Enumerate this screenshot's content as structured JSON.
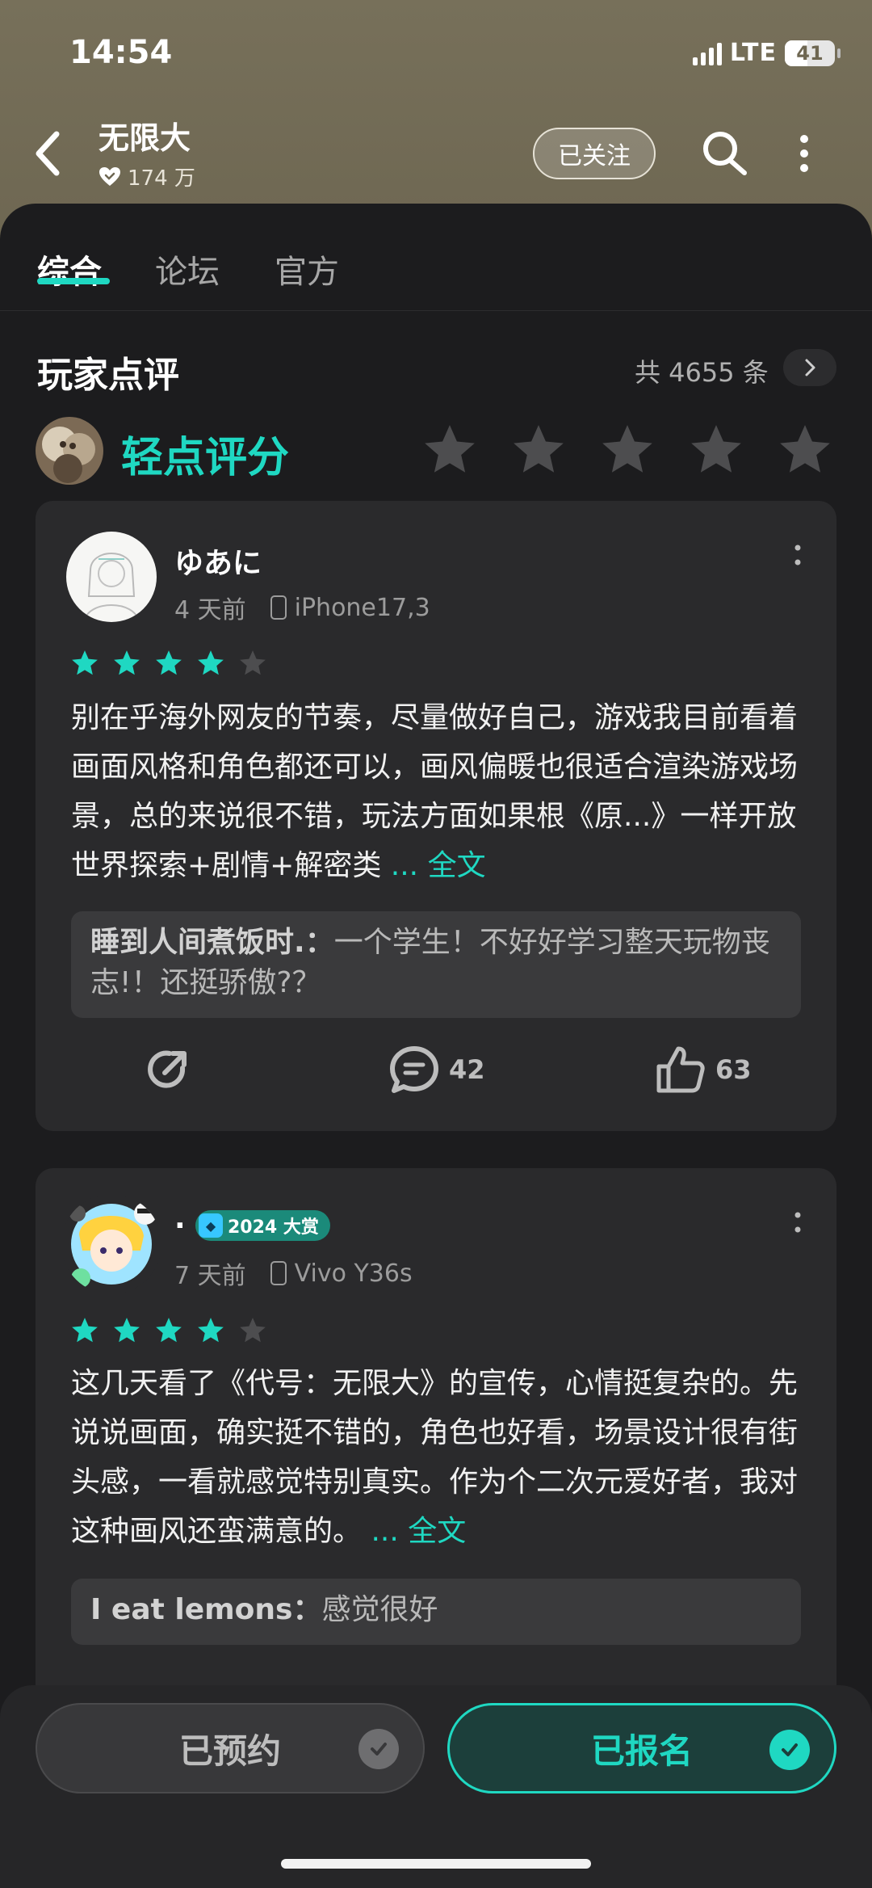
{
  "status_bar": {
    "time": "14:54",
    "network": "LTE",
    "battery": "41"
  },
  "header": {
    "title": "无限大",
    "followers": "174 万",
    "follow_label": "已关注"
  },
  "tabs": [
    {
      "label": "综合",
      "active": true
    },
    {
      "label": "论坛",
      "active": false
    },
    {
      "label": "官方",
      "active": false
    }
  ],
  "reviews_section": {
    "title": "玩家点评",
    "count": "共 4655 条",
    "rate_label": "轻点评分"
  },
  "reviews": [
    {
      "username": "ゆあに",
      "time": "4 天前",
      "device": "iPhone17,3",
      "rating": 4,
      "text": "别在乎海外网友的节奏，尽量做好自己，游戏我目前看着画面风格和角色都还可以，画风偏暖也很适合渲染游戏场景，总的来说很不错，玩法方面如果根《原...》一样开放世界探索+剧情+解密类",
      "more": "... 全文",
      "reply_author": "睡到人间煮饭时.",
      "reply_sep": "：",
      "reply_text": "一个学生！不好好学习整天玩物丧志!！还挺骄傲?？",
      "comments": "42",
      "likes": "63"
    },
    {
      "username": ".",
      "badge": "2024 大赏",
      "time": "7 天前",
      "device": "Vivo Y36s",
      "rating": 4,
      "text": "这几天看了《代号：无限大》的宣传，心情挺复杂的。先说说画面，确实挺不错的，角色也好看，场景设计很有街头感，一看就感觉特别真实。作为个二次元爱好者，我对这种画风还蛮满意的。",
      "more": "... 全文",
      "reply_author": "I eat lemons",
      "reply_sep": "：",
      "reply_text": "感觉很好"
    }
  ],
  "bottom_actions": {
    "reserved_label": "已预约",
    "signed_label": "已报名"
  },
  "colors": {
    "accent": "#1fd8c2",
    "header_bg": "#77705a",
    "page_bg": "#1c1c1e",
    "card_bg": "#2a2a2c"
  }
}
